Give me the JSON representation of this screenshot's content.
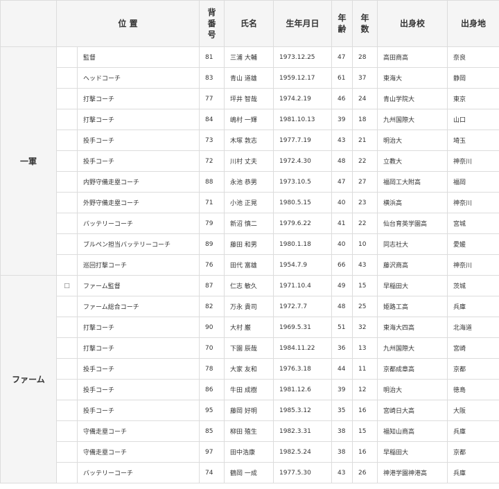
{
  "headers": {
    "position": "位 置",
    "number": "背番号",
    "name": "氏名",
    "birthdate": "生年月日",
    "age": "年齢",
    "years": "年数",
    "school": "出身校",
    "hometown": "出身地"
  },
  "groups": [
    {
      "label": "一軍",
      "rows": [
        {
          "mark": "",
          "position": "監督",
          "number": "81",
          "name": "三浦 大輔",
          "birthdate": "1973.12.25",
          "age": "47",
          "years": "28",
          "school": "高田商高",
          "hometown": "奈良"
        },
        {
          "mark": "",
          "position": "ヘッドコーチ",
          "number": "83",
          "name": "青山 道雄",
          "birthdate": "1959.12.17",
          "age": "61",
          "years": "37",
          "school": "東海大",
          "hometown": "静岡"
        },
        {
          "mark": "",
          "position": "打撃コーチ",
          "number": "77",
          "name": "坪井 智哉",
          "birthdate": "1974.2.19",
          "age": "46",
          "years": "24",
          "school": "青山学院大",
          "hometown": "東京"
        },
        {
          "mark": "",
          "position": "打撃コーチ",
          "number": "84",
          "name": "嶋村 一輝",
          "birthdate": "1981.10.13",
          "age": "39",
          "years": "18",
          "school": "九州国際大",
          "hometown": "山口"
        },
        {
          "mark": "",
          "position": "投手コーチ",
          "number": "73",
          "name": "木塚 敦志",
          "birthdate": "1977.7.19",
          "age": "43",
          "years": "21",
          "school": "明治大",
          "hometown": "埼玉"
        },
        {
          "mark": "",
          "position": "投手コーチ",
          "number": "72",
          "name": "川村 丈夫",
          "birthdate": "1972.4.30",
          "age": "48",
          "years": "22",
          "school": "立教大",
          "hometown": "神奈川"
        },
        {
          "mark": "",
          "position": "内野守備走塁コーチ",
          "number": "88",
          "name": "永池 恭男",
          "birthdate": "1973.10.5",
          "age": "47",
          "years": "27",
          "school": "福岡工大附高",
          "hometown": "福岡"
        },
        {
          "mark": "",
          "position": "外野守備走塁コーチ",
          "number": "71",
          "name": "小池 正晃",
          "birthdate": "1980.5.15",
          "age": "40",
          "years": "23",
          "school": "横浜高",
          "hometown": "神奈川"
        },
        {
          "mark": "",
          "position": "バッテリーコーチ",
          "number": "79",
          "name": "新沼 慎二",
          "birthdate": "1979.6.22",
          "age": "41",
          "years": "22",
          "school": "仙台育英学園高",
          "hometown": "宮城"
        },
        {
          "mark": "",
          "position": "ブルペン担当バッテリーコーチ",
          "number": "89",
          "name": "藤田 和男",
          "birthdate": "1980.1.18",
          "age": "40",
          "years": "10",
          "school": "同志社大",
          "hometown": "愛媛"
        },
        {
          "mark": "",
          "position": "巡回打撃コーチ",
          "number": "76",
          "name": "田代 富雄",
          "birthdate": "1954.7.9",
          "age": "66",
          "years": "43",
          "school": "藤沢商高",
          "hometown": "神奈川"
        }
      ]
    },
    {
      "label": "ファーム",
      "rows": [
        {
          "mark": "□",
          "position": "ファーム監督",
          "number": "87",
          "name": "仁志 敏久",
          "birthdate": "1971.10.4",
          "age": "49",
          "years": "15",
          "school": "早稲田大",
          "hometown": "茨城"
        },
        {
          "mark": "",
          "position": "ファーム総合コーチ",
          "number": "82",
          "name": "万永 貴司",
          "birthdate": "1972.7.7",
          "age": "48",
          "years": "25",
          "school": "姫路工高",
          "hometown": "兵庫"
        },
        {
          "mark": "",
          "position": "打撃コーチ",
          "number": "90",
          "name": "大村 巌",
          "birthdate": "1969.5.31",
          "age": "51",
          "years": "32",
          "school": "東海大四高",
          "hometown": "北海道"
        },
        {
          "mark": "",
          "position": "打撃コーチ",
          "number": "70",
          "name": "下園 辰哉",
          "birthdate": "1984.11.22",
          "age": "36",
          "years": "13",
          "school": "九州国際大",
          "hometown": "宮崎"
        },
        {
          "mark": "",
          "position": "投手コーチ",
          "number": "78",
          "name": "大家 友和",
          "birthdate": "1976.3.18",
          "age": "44",
          "years": "11",
          "school": "京都成章高",
          "hometown": "京都"
        },
        {
          "mark": "",
          "position": "投手コーチ",
          "number": "86",
          "name": "牛田 成樹",
          "birthdate": "1981.12.6",
          "age": "39",
          "years": "12",
          "school": "明治大",
          "hometown": "徳島"
        },
        {
          "mark": "",
          "position": "投手コーチ",
          "number": "95",
          "name": "藤岡 好明",
          "birthdate": "1985.3.12",
          "age": "35",
          "years": "16",
          "school": "宮崎日大高",
          "hometown": "大阪"
        },
        {
          "mark": "",
          "position": "守備走塁コーチ",
          "number": "85",
          "name": "柳田 殖生",
          "birthdate": "1982.3.31",
          "age": "38",
          "years": "15",
          "school": "福知山商高",
          "hometown": "兵庫"
        },
        {
          "mark": "",
          "position": "守備走塁コーチ",
          "number": "97",
          "name": "田中浩康",
          "birthdate": "1982.5.24",
          "age": "38",
          "years": "16",
          "school": "早稲田大",
          "hometown": "京都"
        },
        {
          "mark": "",
          "position": "バッテリーコーチ",
          "number": "74",
          "name": "鶴岡 一成",
          "birthdate": "1977.5.30",
          "age": "43",
          "years": "26",
          "school": "神港学園神港高",
          "hometown": "兵庫"
        }
      ]
    }
  ]
}
